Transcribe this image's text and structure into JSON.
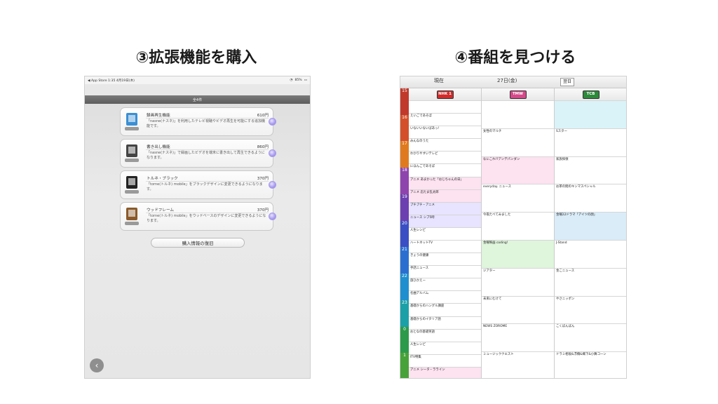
{
  "headings": {
    "left": "③拡張機能を購入",
    "right": "④番組を見つける"
  },
  "store": {
    "status": {
      "carrier": "◀ App Store",
      "time": "1:35",
      "date": "4月19日(木)",
      "battery": "85%"
    },
    "count_label": "全4件",
    "items": [
      {
        "name": "録画再生機能",
        "price": "610円",
        "desc": "「nasne(ナスネ)」を利用したテレビ視聴やビデオ再生を可能にする追加機能です。",
        "thumb_color": "#3a8fd4"
      },
      {
        "name": "書き出し機能",
        "price": "860円",
        "desc": "「nasne(ナスネ)」で録画したビデオを端末に書き出して再生できるようになります。",
        "thumb_color": "#444444"
      },
      {
        "name": "トルネ・ブラック",
        "price": "370円",
        "desc": "「torne(トルネ) mobile」をブラックデザインに変更できるようになります。",
        "thumb_color": "#222222"
      },
      {
        "name": "ウッドフレーム",
        "price": "370円",
        "desc": "「torne(トルネ) mobile」をウッドベースのデザインに変更できるようになります。",
        "thumb_color": "#8a5a2b"
      }
    ],
    "restore_label": "購入情報の復旧",
    "back_icon": "chevron-left-icon"
  },
  "epg": {
    "toolbar": {
      "now_label": "現在",
      "date_label": "27日(金)",
      "button_label": "翌日"
    },
    "channels": [
      {
        "logo": "NHK 1",
        "color": "#d12b2b"
      },
      {
        "logo": "TMW",
        "color": "#d44a8a"
      },
      {
        "logo": "TCB",
        "color": "#2d8a3a"
      }
    ],
    "hours": [
      {
        "label": "15",
        "color": "#c0392b"
      },
      {
        "label": "16",
        "color": "#d4502a"
      },
      {
        "label": "17",
        "color": "#e07a1e"
      },
      {
        "label": "18",
        "color": "#8e44ad"
      },
      {
        "label": "19",
        "color": "#6c3fb0"
      },
      {
        "label": "20",
        "color": "#3b4fc4"
      },
      {
        "label": "21",
        "color": "#2a6fd0"
      },
      {
        "label": "22",
        "color": "#1f8fcf"
      },
      {
        "label": "23",
        "color": "#1ba0a8"
      },
      {
        "label": "0",
        "color": "#2c9a4a"
      },
      {
        "label": "1",
        "color": "#48a23a"
      }
    ],
    "columns": [
      [
        {
          "min": "",
          "title": "",
          "desc": "",
          "bg": "#ffffff"
        },
        {
          "min": "",
          "title": "えいごであそぼ",
          "desc": "",
          "bg": "#ffffff"
        },
        {
          "min": "",
          "title": "いないいないばあっ!",
          "desc": "",
          "bg": "#ffffff"
        },
        {
          "min": "",
          "title": "みんなのうた",
          "desc": "",
          "bg": "#ffffff"
        },
        {
          "min": "",
          "title": "わかりやすいテレビ",
          "desc": "",
          "bg": "#ffffff"
        },
        {
          "min": "",
          "title": "にほんごであそぼ",
          "desc": "",
          "bg": "#ffffff"
        },
        {
          "min": "",
          "title": "アニメ あまかった「おじちゃんの日」",
          "desc": "",
          "bg": "#fde2f0"
        },
        {
          "min": "",
          "title": "アニメ 忍たま乱太郎",
          "desc": "",
          "bg": "#fde2f0"
        },
        {
          "min": "",
          "title": "プチプチ・アニメ",
          "desc": "",
          "bg": "#e8e3ff"
        },
        {
          "min": "",
          "title": "ニュース シブ5時",
          "desc": "",
          "bg": "#e8e3ff"
        },
        {
          "min": "",
          "title": "人生レシピ",
          "desc": "",
          "bg": "#ffffff"
        },
        {
          "min": "",
          "title": "ハートネットTV",
          "desc": "",
          "bg": "#ffffff"
        },
        {
          "min": "",
          "title": "きょうの健康",
          "desc": "",
          "bg": "#ffffff"
        },
        {
          "min": "",
          "title": "手話ニュース",
          "desc": "",
          "bg": "#ffffff"
        },
        {
          "min": "",
          "title": "旅ひかえー",
          "desc": "",
          "bg": "#ffffff"
        },
        {
          "min": "",
          "title": "名曲アルバム",
          "desc": "",
          "bg": "#ffffff"
        },
        {
          "min": "",
          "title": "基礎からのハングル講座",
          "desc": "",
          "bg": "#ffffff"
        },
        {
          "min": "",
          "title": "基礎からのイタリア語",
          "desc": "",
          "bg": "#ffffff"
        },
        {
          "min": "",
          "title": "おとなの基礎英語",
          "desc": "",
          "bg": "#ffffff"
        },
        {
          "min": "",
          "title": "人生レシピ",
          "desc": "",
          "bg": "#ffffff"
        },
        {
          "min": "",
          "title": "ITV特集",
          "desc": "",
          "bg": "#ffffff"
        },
        {
          "min": "",
          "title": "アニメ シータ・ラライン",
          "desc": "",
          "bg": "#fde2f0"
        }
      ],
      [
        {
          "min": "",
          "title": "",
          "desc": "",
          "bg": "#ffffff"
        },
        {
          "min": "",
          "title": "女性のマルチ",
          "desc": "",
          "bg": "#ffffff"
        },
        {
          "min": "",
          "title": "なにこれ!?アンデパンダン",
          "desc": "",
          "bg": "#fde2f0"
        },
        {
          "min": "",
          "title": "everyday. ニュース",
          "desc": "",
          "bg": "#ffffff"
        },
        {
          "min": "",
          "title": "今夜たべてみました",
          "desc": "",
          "bg": "#ffffff"
        },
        {
          "min": "",
          "title": "金曜映画 coding!",
          "desc": "",
          "bg": "#dff5dc"
        },
        {
          "min": "",
          "title": "ジアター",
          "desc": "",
          "bg": "#ffffff"
        },
        {
          "min": "",
          "title": "未来にむけて",
          "desc": "",
          "bg": "#ffffff"
        },
        {
          "min": "",
          "title": "NEWS ZOROME",
          "desc": "",
          "bg": "#ffffff"
        },
        {
          "min": "",
          "title": "ミュージッククエスト",
          "desc": "",
          "bg": "#ffffff"
        }
      ],
      [
        {
          "min": "",
          "title": "",
          "desc": "",
          "bg": "#d9f3f8"
        },
        {
          "min": "",
          "title": "Sスター",
          "desc": "",
          "bg": "#ffffff"
        },
        {
          "min": "",
          "title": "家族探偵",
          "desc": "",
          "bg": "#ffffff"
        },
        {
          "min": "",
          "title": "お茶の間のキンマスペシャル",
          "desc": "",
          "bg": "#ffffff"
        },
        {
          "min": "",
          "title": "金曜22ドラマ「アイツの顔」",
          "desc": "",
          "bg": "#d9ecf8"
        },
        {
          "min": "",
          "title": "J-Stand",
          "desc": "",
          "bg": "#ffffff"
        },
        {
          "min": "",
          "title": "金こニュース",
          "desc": "",
          "bg": "#ffffff"
        },
        {
          "min": "",
          "title": "やさニッポン",
          "desc": "",
          "bg": "#ffffff"
        },
        {
          "min": "",
          "title": "こくばんばん",
          "desc": "",
          "bg": "#ffffff"
        },
        {
          "min": "",
          "title": "ドラミ相坂&浮橋&織下&小舞コーン",
          "desc": "",
          "bg": "#ffffff"
        }
      ]
    ]
  }
}
